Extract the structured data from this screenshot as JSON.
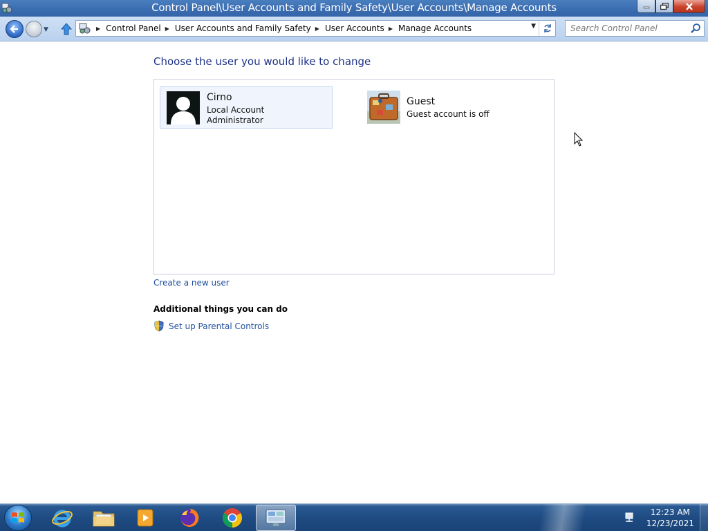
{
  "window": {
    "title": "Control Panel\\User Accounts and Family Safety\\User Accounts\\Manage Accounts",
    "controls": {
      "minimize": "minimize",
      "maximize": "maximize",
      "close": "close"
    }
  },
  "navigation": {
    "breadcrumbs": [
      "Control Panel",
      "User Accounts and Family Safety",
      "User Accounts",
      "Manage Accounts"
    ],
    "search_placeholder": "Search Control Panel"
  },
  "main": {
    "heading": "Choose the user you would like to change",
    "accounts": [
      {
        "name": "Cirno",
        "lines": [
          "Local Account",
          "Administrator"
        ],
        "selected": true
      },
      {
        "name": "Guest",
        "lines": [
          "Guest account is off"
        ],
        "selected": false
      }
    ],
    "create_link": "Create a new user",
    "additional_heading": "Additional things you can do",
    "parental_link": "Set up Parental Controls"
  },
  "taskbar": {
    "pinned": [
      "internet-explorer",
      "windows-explorer",
      "media-player",
      "firefox",
      "chrome",
      "control-panel"
    ],
    "active": "control-panel",
    "clock": {
      "time": "12:23 AM",
      "date": "12/23/2021"
    }
  },
  "colors": {
    "heading": "#1e3287",
    "link": "#1e4e9e",
    "titlebar": "#3a6cb0",
    "taskbar": "#1e4b82"
  }
}
